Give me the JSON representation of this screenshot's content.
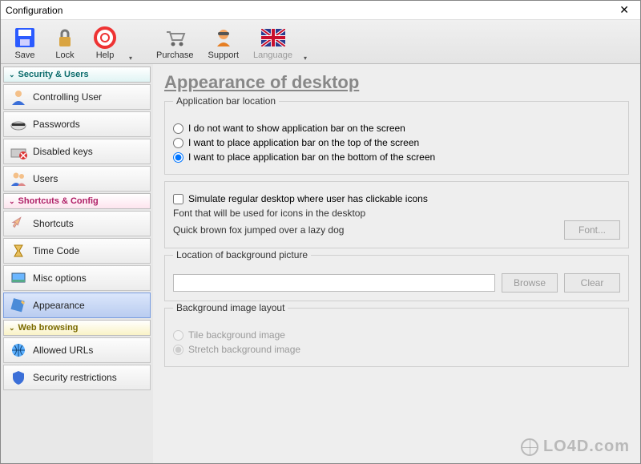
{
  "window": {
    "title": "Configuration"
  },
  "toolbar": {
    "save": "Save",
    "lock": "Lock",
    "help": "Help",
    "purchase": "Purchase",
    "support": "Support",
    "language": "Language"
  },
  "sidebar": {
    "groups": [
      {
        "title": "Security & Users",
        "style": "teal",
        "items": [
          "Controlling User",
          "Passwords",
          "Disabled keys",
          "Users"
        ]
      },
      {
        "title": "Shortcuts & Config",
        "style": "pink",
        "items": [
          "Shortcuts",
          "Time Code",
          "Misc options",
          "Appearance"
        ]
      },
      {
        "title": "Web browsing",
        "style": "yellow",
        "items": [
          "Allowed URLs",
          "Security restrictions"
        ]
      }
    ],
    "selected": "Appearance"
  },
  "content": {
    "heading": "Appearance of desktop",
    "appbar": {
      "legend": "Application bar location",
      "options": [
        "I do not want to show application bar on the screen",
        "I want to place application bar on the top of the screen",
        "I want to place application bar on the bottom of the screen"
      ],
      "selected": 2
    },
    "desktop": {
      "simulate_label": "Simulate regular desktop where user has clickable icons",
      "simulate_checked": false,
      "font_caption": "Font that will be used for icons in the desktop",
      "font_sample": "Quick brown fox jumped over a lazy dog",
      "font_button": "Font..."
    },
    "background": {
      "legend": "Location of background picture",
      "path": "",
      "browse": "Browse",
      "clear": "Clear"
    },
    "layout": {
      "legend": "Background image layout",
      "options": [
        "Tile background image",
        "Stretch background image"
      ],
      "selected": 1,
      "enabled": false
    }
  },
  "watermark": "LO4D.com"
}
